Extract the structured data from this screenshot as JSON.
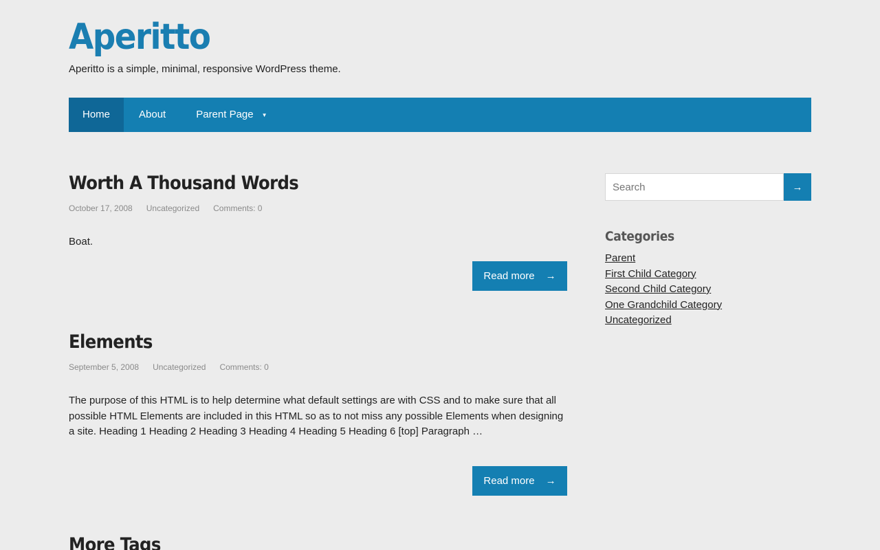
{
  "site": {
    "title": "Aperitto",
    "description": "Aperitto is a simple, minimal, responsive WordPress theme."
  },
  "nav": {
    "items": [
      {
        "label": "Home"
      },
      {
        "label": "About"
      },
      {
        "label": "Parent Page",
        "caret": "▼"
      }
    ]
  },
  "posts": [
    {
      "title": "Worth A Thousand Words",
      "date": "October 17, 2008",
      "category": "Uncategorized",
      "comments": "Comments: 0",
      "excerpt": "Boat.",
      "read_more": "Read more",
      "arrow": "→"
    },
    {
      "title": "Elements",
      "date": "September 5, 2008",
      "category": "Uncategorized",
      "comments": "Comments: 0",
      "excerpt": "The purpose of this HTML is to help determine what default settings are with CSS and to make sure that all possible HTML Elements are included in this HTML so as to not miss any possible Elements when designing a site. Heading 1 Heading 2 Heading 3 Heading 4 Heading 5 Heading 6 [top] Paragraph …",
      "read_more": "Read more",
      "arrow": "→"
    },
    {
      "title": "More Tags"
    }
  ],
  "sidebar": {
    "search": {
      "placeholder": "Search",
      "button_icon": "→"
    },
    "categories": {
      "title": "Categories",
      "items": [
        {
          "label": "Parent"
        },
        {
          "label": "First Child Category"
        },
        {
          "label": "Second Child Category"
        },
        {
          "label": "One Grandchild Category"
        },
        {
          "label": "Uncategorized"
        }
      ]
    }
  },
  "colors": {
    "accent": "#147fb2",
    "accent_dark": "#0f6797",
    "title": "#1a7eb1",
    "background": "#ececec"
  }
}
